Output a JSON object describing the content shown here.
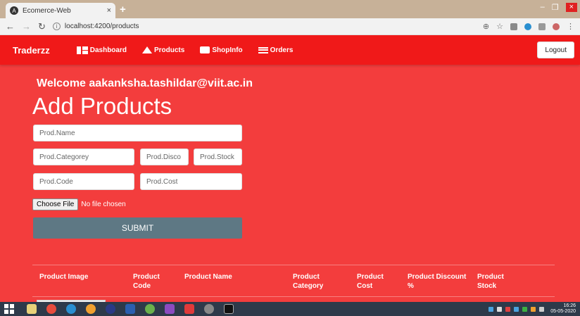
{
  "browser": {
    "tab_title": "Ecomerce-Web",
    "tab_close": "×",
    "new_tab": "+",
    "url": "localhost:4200/products",
    "window_controls": [
      "–",
      "❐",
      "×"
    ]
  },
  "navbar": {
    "brand": "Traderzz",
    "links": [
      {
        "label": "Dashboard",
        "icon": "dashboard-icon"
      },
      {
        "label": "Products",
        "icon": "shapes-icon"
      },
      {
        "label": "ShopInfo",
        "icon": "shop-icon"
      },
      {
        "label": "Orders",
        "icon": "hamburger-icon"
      }
    ],
    "logout_label": "Logout"
  },
  "page": {
    "welcome": "Welcome aakanksha.tashildar@viit.ac.in",
    "title": "Add Products"
  },
  "form": {
    "name_placeholder": "Prod.Name",
    "category_placeholder": "Prod.Categorey",
    "discount_placeholder": "Prod.Disco",
    "stock_placeholder": "Prod.Stock",
    "code_placeholder": "Prod.Code",
    "cost_placeholder": "Prod.Cost",
    "file_button": "Choose File",
    "file_status": "No file chosen",
    "submit_label": "SUBMIT"
  },
  "table": {
    "columns": [
      [
        "",
        "Product Image"
      ],
      [
        "Product",
        "Code"
      ],
      [
        "",
        "Product Name"
      ],
      [
        "Product",
        "Category"
      ],
      [
        "Product",
        "Cost"
      ],
      [
        "Product Discount",
        "%"
      ],
      [
        "Product",
        "Stock"
      ]
    ]
  },
  "taskbar": {
    "clock_time": "16:26",
    "clock_date": "05-05-2020"
  },
  "colors": {
    "navbar": "#f01919",
    "page_bg": "#f33d3d",
    "submit": "#5e7884"
  }
}
